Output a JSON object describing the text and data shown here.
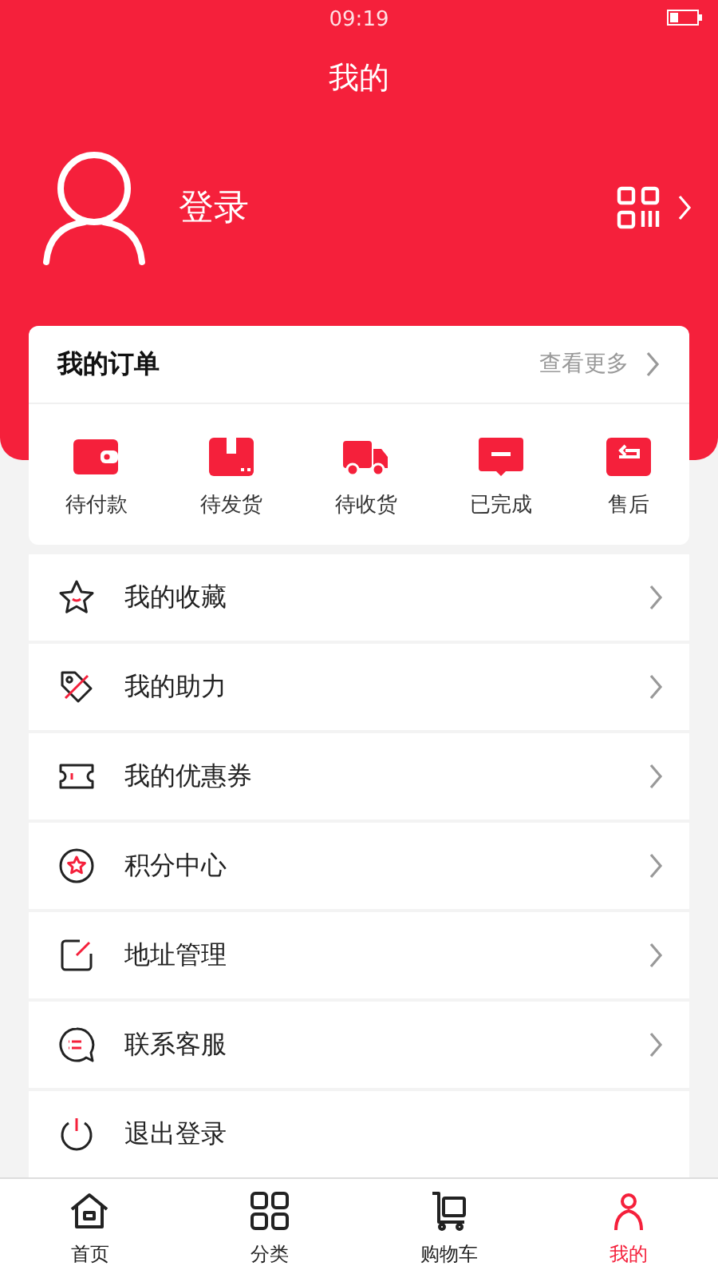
{
  "status_bar": {
    "time": "09:19"
  },
  "header": {
    "title": "我的",
    "login": "登录"
  },
  "orders": {
    "title": "我的订单",
    "more": "查看更多",
    "items": [
      {
        "kind": "wallet",
        "label": "待付款"
      },
      {
        "kind": "box",
        "label": "待发货"
      },
      {
        "kind": "truck",
        "label": "待收货"
      },
      {
        "kind": "message",
        "label": "已完成"
      },
      {
        "kind": "return",
        "label": "售后"
      }
    ]
  },
  "menu": [
    {
      "kind": "star",
      "label": "我的收藏",
      "arrow": true
    },
    {
      "kind": "tag",
      "label": "我的助力",
      "arrow": true
    },
    {
      "kind": "ticket",
      "label": "我的优惠券",
      "arrow": true
    },
    {
      "kind": "points",
      "label": "积分中心",
      "arrow": true
    },
    {
      "kind": "edit",
      "label": "地址管理",
      "arrow": true
    },
    {
      "kind": "chat",
      "label": "联系客服",
      "arrow": true
    },
    {
      "kind": "power",
      "label": "退出登录",
      "arrow": false
    }
  ],
  "tabs": [
    {
      "kind": "home",
      "label": "首页",
      "selected": false
    },
    {
      "kind": "grid",
      "label": "分类",
      "selected": false
    },
    {
      "kind": "cart",
      "label": "购物车",
      "selected": false
    },
    {
      "kind": "user",
      "label": "我的",
      "selected": true
    }
  ]
}
